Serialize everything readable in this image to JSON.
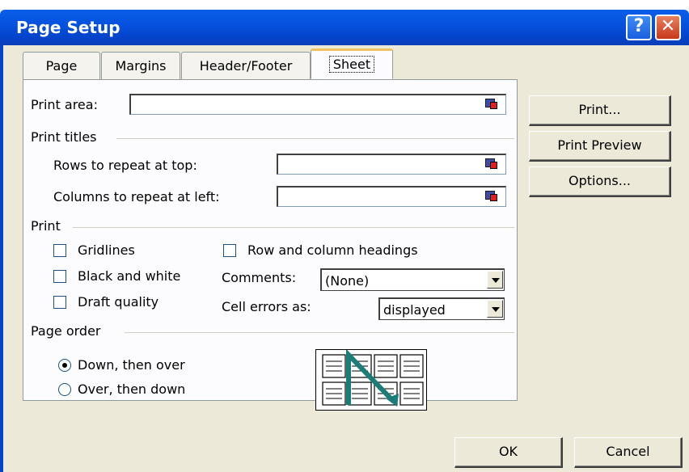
{
  "window": {
    "title": "Page Setup",
    "help_glyph": "?",
    "close_glyph": "✕"
  },
  "tabs": [
    {
      "label": "Page"
    },
    {
      "label": "Margins"
    },
    {
      "label": "Header/Footer"
    },
    {
      "label": "Sheet",
      "active": true
    }
  ],
  "print_area": {
    "label": "Print area:",
    "value": ""
  },
  "print_titles": {
    "heading": "Print titles",
    "rows_label": "Rows to repeat at top:",
    "rows_value": "",
    "cols_label": "Columns to repeat at left:",
    "cols_value": ""
  },
  "print": {
    "heading": "Print",
    "gridlines": "Gridlines",
    "black_white": "Black and white",
    "draft": "Draft quality",
    "row_col_headings": "Row and column headings",
    "comments_label": "Comments:",
    "comments_value": "(None)",
    "cell_errors_label": "Cell errors as:",
    "cell_errors_value": "displayed"
  },
  "page_order": {
    "heading": "Page order",
    "down_over": "Down, then over",
    "over_down": "Over, then down",
    "selected": "down_over"
  },
  "buttons": {
    "print": "Print...",
    "print_preview": "Print Preview",
    "options": "Options...",
    "ok": "OK",
    "cancel": "Cancel"
  },
  "colors": {
    "titlebar": "#0552df",
    "dialog_bg": "#ece9d8",
    "active_tab_accent": "#f1c15f",
    "preview_arrow": "#1a7d78"
  }
}
